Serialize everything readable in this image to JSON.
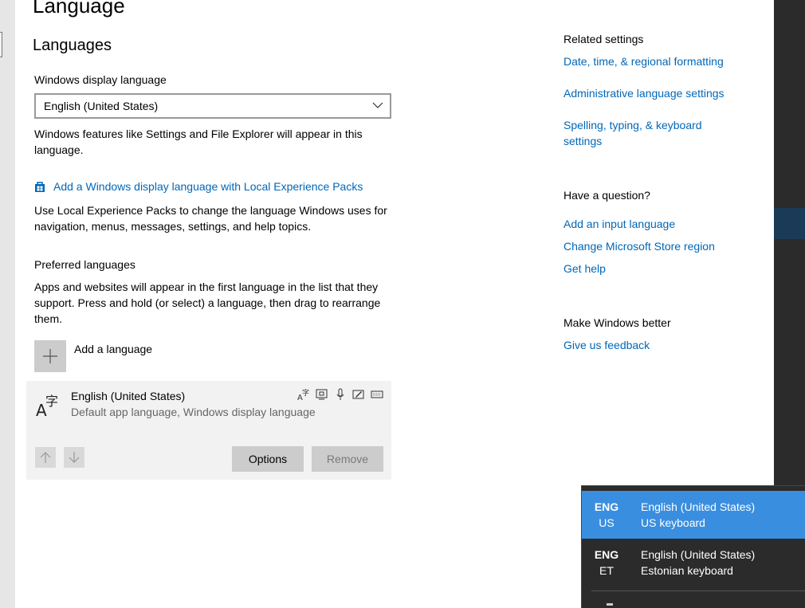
{
  "page": {
    "title": "Language",
    "section_title": "Languages"
  },
  "display_language": {
    "label": "Windows display language",
    "selected": "English (United States)",
    "description": "Windows features like Settings and File Explorer will appear in this language."
  },
  "local_experience": {
    "link": "Add a Windows display language with Local Experience Packs",
    "description": "Use Local Experience Packs to change the language Windows uses for navigation, menus, messages, settings, and help topics."
  },
  "preferred": {
    "label": "Preferred languages",
    "description": "Apps and websites will appear in the first language in the list that they support. Press and hold (or select) a language, then drag to rearrange them.",
    "add_label": "Add a language",
    "languages": [
      {
        "name": "English (United States)",
        "subtitle": "Default app language, Windows display language",
        "options_label": "Options",
        "remove_label": "Remove"
      }
    ]
  },
  "related": {
    "heading": "Related settings",
    "links": [
      "Date, time, & regional formatting",
      "Administrative language settings",
      "Spelling, typing, & keyboard settings"
    ]
  },
  "question": {
    "heading": "Have a question?",
    "links": [
      "Add an input language",
      "Change Microsoft Store region",
      "Get help"
    ]
  },
  "feedback": {
    "heading": "Make Windows better",
    "link": "Give us feedback"
  },
  "ime_flyout": {
    "items": [
      {
        "code1": "ENG",
        "code2": "US",
        "lang": "English (United States)",
        "keyboard": "US keyboard",
        "active": true
      },
      {
        "code1": "ENG",
        "code2": "ET",
        "lang": "English (United States)",
        "keyboard": "Estonian keyboard",
        "active": false
      }
    ]
  },
  "colors": {
    "link": "#0067b8",
    "flyout_active": "#3a8ee0",
    "flyout_bg": "#2b2b2b"
  }
}
